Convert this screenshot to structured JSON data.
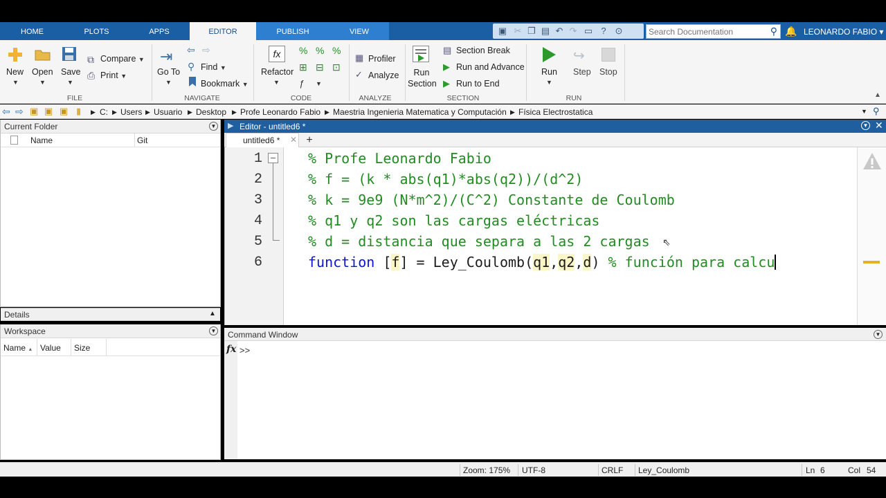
{
  "tabs": [
    "HOME",
    "PLOTS",
    "APPS",
    "EDITOR",
    "PUBLISH",
    "VIEW"
  ],
  "search": {
    "placeholder": "Search Documentation"
  },
  "user": "LEONARDO FABIO",
  "ribbon": {
    "file": {
      "new": "New",
      "open": "Open",
      "save": "Save",
      "compare": "Compare",
      "print": "Print",
      "group": "FILE"
    },
    "navigate": {
      "goto": "Go To",
      "find": "Find",
      "bookmark": "Bookmark",
      "group": "NAVIGATE"
    },
    "code": {
      "refactor": "Refactor",
      "group": "CODE"
    },
    "analyze": {
      "profiler": "Profiler",
      "analyze": "Analyze",
      "group": "ANALYZE"
    },
    "section": {
      "run_section": "Run\nSection",
      "run_section_l1": "Run",
      "run_section_l2": "Section",
      "section_break": "Section Break",
      "run_and_advance": "Run and Advance",
      "run_to_end": "Run to End",
      "group": "SECTION"
    },
    "run": {
      "run": "Run",
      "step": "Step",
      "stop": "Stop",
      "group": "RUN"
    }
  },
  "path": [
    "C:",
    "Users",
    "Usuario",
    "Desktop",
    "Profe Leonardo Fabio",
    "Maestria Ingenieria Matematica y Computación",
    "Física Electrostatica"
  ],
  "current_folder": {
    "title": "Current Folder",
    "col_name": "Name",
    "col_git": "Git"
  },
  "details": {
    "title": "Details"
  },
  "workspace": {
    "title": "Workspace",
    "col_name": "Name",
    "sort_mark": "▲",
    "col_value": "Value",
    "col_size": "Size"
  },
  "editor": {
    "title": "Editor - untitled6 *",
    "tab": "untitled6 *",
    "lines": [
      {
        "num": "1",
        "text": "% Profe Leonardo Fabio"
      },
      {
        "num": "2",
        "text": "% f = (k * abs(q1)*abs(q2))/(d^2)"
      },
      {
        "num": "3",
        "text": "% k = 9e9 (N*m^2)/(C^2) Constante de Coulomb"
      },
      {
        "num": "4",
        "text": "% q1 y q2 son las cargas eléctricas"
      },
      {
        "num": "5",
        "text": "% d = distancia que separa a las 2 cargas"
      },
      {
        "num": "6",
        "text": "function [f] = Ley_Coulomb(q1,q2,d) % función para calcu"
      }
    ],
    "line6": {
      "kw": "function",
      "open": " [",
      "out": "f",
      "mid": "] = Ley_Coulomb(",
      "a1": "q1",
      "c1": ",",
      "a2": "q2",
      "c2": ",",
      "a3": "d",
      "close": ")",
      "comment": " % función para calcu"
    }
  },
  "command_window": {
    "title": "Command Window",
    "fx": "fx",
    "prompt": ">>"
  },
  "statusbar": {
    "zoom": "Zoom: 175%",
    "encoding": "UTF-8",
    "eol": "CRLF",
    "func": "Ley_Coulomb",
    "ln_label": "Ln",
    "ln": "6",
    "col_label": "Col",
    "col": "54"
  }
}
